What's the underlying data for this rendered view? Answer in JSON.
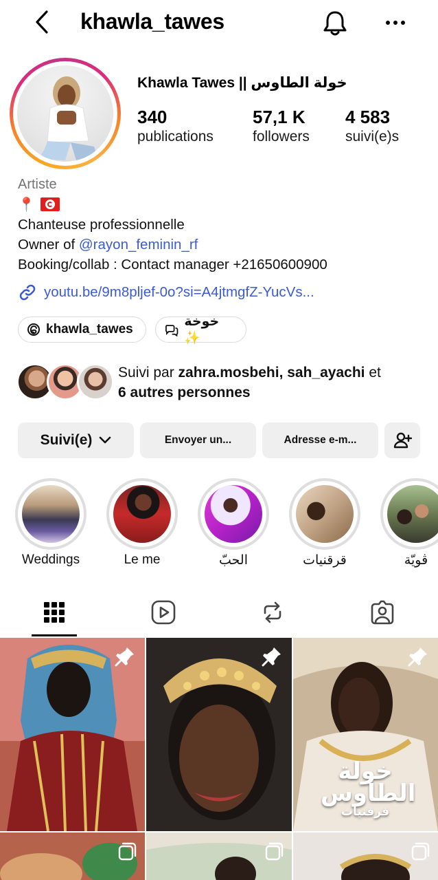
{
  "header": {
    "username": "khawla_tawes",
    "back_icon": "chevron-left-icon",
    "notifications_icon": "bell-icon",
    "more_icon": "more-horizontal-icon"
  },
  "profile": {
    "full_name": "Khawla Tawes || خولة الطاوس",
    "stats": [
      {
        "value": "340",
        "label": "publications"
      },
      {
        "value": "57,1 K",
        "label": "followers"
      },
      {
        "value": "4 583",
        "label": "suivi(e)s"
      }
    ],
    "category": "Artiste",
    "emoji_line": [
      "📍",
      "🇹🇳"
    ],
    "bio": {
      "line1": "Chanteuse professionnelle",
      "line2_prefix": "Owner of ",
      "line2_mention": "@rayon_feminin_rf",
      "line3": "Booking/collab : Contact manager +21650600900"
    },
    "link": "youtu.be/9m8pljef-0o?si=A4jtmgfZ-YucVs...",
    "chips": [
      {
        "label": "khawla_tawes",
        "icon": "threads-icon"
      },
      {
        "label": "خوخة ✨",
        "icon": "chat-bubbles-icon"
      }
    ]
  },
  "followed_by": {
    "prefix": "Suivi par ",
    "names": "zahra.mosbehi, sah_ayachi",
    "connector": " et",
    "others": "6 autres personnes"
  },
  "actions": {
    "following_label": "Suivi(e)",
    "message_label": "Envoyer un...",
    "email_label": "Adresse e-m...",
    "add_user_icon": "add-person-icon"
  },
  "highlights": [
    {
      "label": "Weddings"
    },
    {
      "label": "Le me"
    },
    {
      "label": "الحبّ"
    },
    {
      "label": "قرقنيات"
    },
    {
      "label": "ڨويّة"
    }
  ],
  "tabs": [
    {
      "name": "grid",
      "icon": "grid-icon",
      "active": true
    },
    {
      "name": "reels",
      "icon": "reels-icon",
      "active": false
    },
    {
      "name": "reposts",
      "icon": "repost-icon",
      "active": false
    },
    {
      "name": "tagged",
      "icon": "tagged-person-icon",
      "active": false
    }
  ],
  "grid": {
    "tile3_title_line1": "خولة",
    "tile3_title_line2": "الطاوس",
    "tile3_subtitle": "قرقنيات"
  },
  "colors": {
    "link_blue": "#3a5ad6",
    "button_gray": "#efefef",
    "secondary_text": "#737373"
  }
}
